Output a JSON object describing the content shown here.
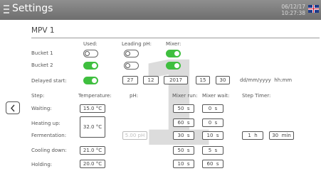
{
  "header": {
    "title": "Settings",
    "date": "06/12/17",
    "time": "10:27:38"
  },
  "section": {
    "title": "MPV 1",
    "watermark": "1"
  },
  "columns": {
    "used": "Used:",
    "leading_ph": "Leading pH:",
    "mixer": "Mixer:"
  },
  "buckets": [
    {
      "label": "Bucket 1",
      "used": false,
      "leading_ph": false,
      "mixer": true
    },
    {
      "label": "Bucket 2",
      "used": true,
      "leading_ph": false,
      "mixer": true
    }
  ],
  "delayed_start": {
    "label": "Delayed start:",
    "enabled": true,
    "day": "27",
    "month": "12",
    "year": "2017",
    "hour": "15",
    "minute": "30",
    "format": "dd/mm/yyyy  hh:mm"
  },
  "steps_header": {
    "step": "Step:",
    "temperature": "Temperature:",
    "ph": "pH:",
    "mixer_run": "Mixer run:",
    "mixer_wait": "Mixer wait:",
    "step_timer": "Step Timer:"
  },
  "steps": {
    "waiting": {
      "label": "Waiting:",
      "temperature": "15.0 °C",
      "mixer_run": "50  s",
      "mixer_wait": "0  s"
    },
    "heating": {
      "label": "Heating up:",
      "mixer_run": "60  s",
      "mixer_wait": "0  s"
    },
    "fermentation": {
      "label": "Fermentation:",
      "ph": "5.00 pH",
      "mixer_run": "30  s",
      "mixer_wait": "10  s",
      "timer_h": "1  h",
      "timer_min": "30  min"
    },
    "shared_temperature": "32.0 °C",
    "cooling": {
      "label": "Cooling down:",
      "temperature": "21.0 °C",
      "mixer_run": "50  s",
      "mixer_wait": "5  s"
    },
    "holding": {
      "label": "Holding:",
      "temperature": "20.0 °C",
      "mixer_run": "10  s",
      "mixer_wait": "60  s"
    }
  },
  "icons": {
    "menu": "hamburger-menu-icon",
    "flag": "uk-flag-icon",
    "back": "chevron-left-icon"
  },
  "colors": {
    "header": "#7a7a7a",
    "toggle_on": "#3fbf3f"
  }
}
